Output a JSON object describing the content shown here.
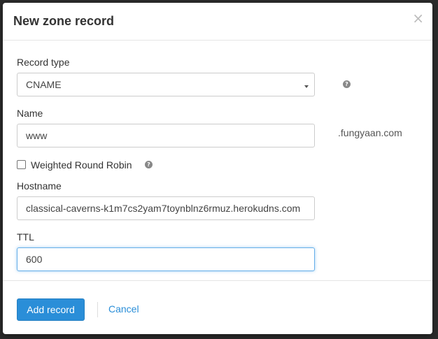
{
  "modal": {
    "title": "New zone record",
    "close_symbol": "×"
  },
  "form": {
    "record_type": {
      "label": "Record type",
      "selected": "CNAME",
      "help_icon": "question-circle-icon"
    },
    "name": {
      "label": "Name",
      "value": "www",
      "suffix": ".fungyaan.com"
    },
    "weighted_round_robin": {
      "label": "Weighted Round Robin",
      "checked": false,
      "help_icon": "question-circle-icon"
    },
    "hostname": {
      "label": "Hostname",
      "value": "classical-caverns-k1m7cs2yam7toynblnz6rmuz.herokudns.com"
    },
    "ttl": {
      "label": "TTL",
      "value": "600"
    }
  },
  "footer": {
    "add_label": "Add record",
    "cancel_label": "Cancel"
  },
  "colors": {
    "primary": "#2a8ed8",
    "focus_border": "#66afe9",
    "backdrop": "#2b2b2b"
  }
}
